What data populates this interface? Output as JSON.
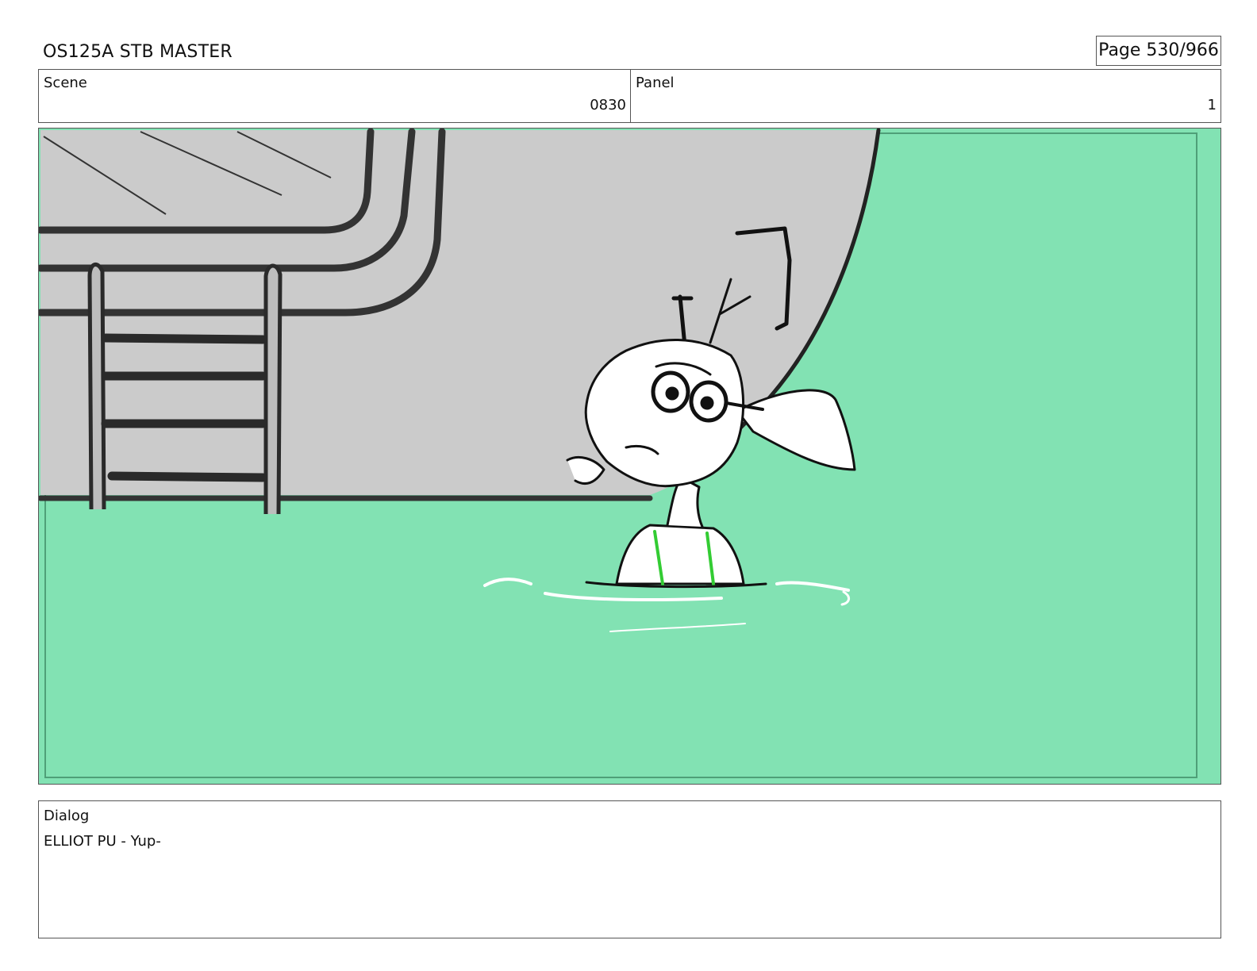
{
  "header": {
    "title": "OS125A STB MASTER",
    "page_label": "Page 530/966"
  },
  "info": {
    "scene_label": "Scene",
    "scene_value": "0830",
    "panel_label": "Panel",
    "panel_value": "1"
  },
  "frame": {
    "water_color": "#82e2b3",
    "wall_color": "#cbcbcb",
    "line_color": "#222222"
  },
  "dialog": {
    "label": "Dialog",
    "text": "ELLIOT PU - Yup-"
  }
}
